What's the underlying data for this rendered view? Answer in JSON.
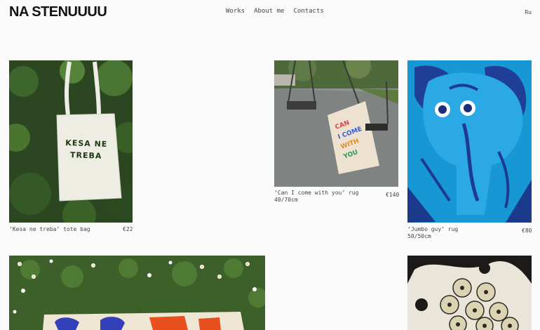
{
  "header": {
    "logo": "NA STENUUUU",
    "nav": [
      "Works",
      "About me",
      "Contacts"
    ],
    "lang": "Ru"
  },
  "products": [
    {
      "title": "‘Kesa ne treba’ tote bag",
      "size": "",
      "price": "€22",
      "print": "KESA NE TREBA"
    },
    {
      "title": "‘Can I come with you’ rug",
      "size": "40/70cm",
      "price": "€140"
    },
    {
      "title": "‘Jumbo guy’ rug",
      "size": "50/50cm",
      "price": "€80"
    }
  ]
}
